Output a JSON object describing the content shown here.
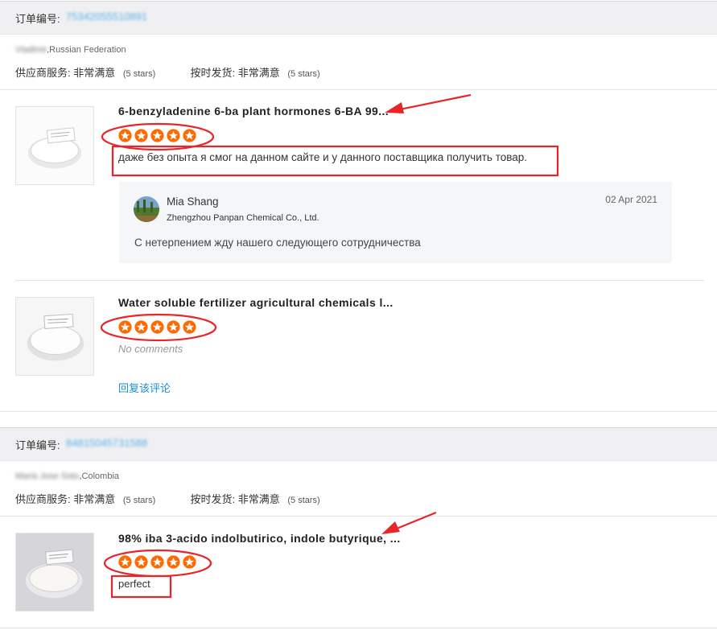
{
  "orders": [
    {
      "order_label": "订单编号:",
      "order_number": "75342055510891",
      "buyer_name": "Vladimir",
      "country": ",Russian Federation",
      "supplier_service_label": "供应商服务:",
      "supplier_service_value": "非常满意",
      "supplier_service_stars": "(5 stars)",
      "shipping_label": "按时发货:",
      "shipping_value": "非常满意",
      "shipping_stars": "(5 stars)",
      "products": [
        {
          "title": "6-benzyladenine 6-ba plant hormones 6-BA 99...",
          "rating": 5,
          "review": "даже без опыта я смог на данном сайте и у данного поставщика получить товар.",
          "reply": {
            "name": "Mia Shang",
            "company": "Zhengzhou Panpan Chemical Co., Ltd.",
            "date": "02 Apr 2021",
            "message": "С нетерпением жду нашего следующего сотрудничества"
          }
        },
        {
          "title": "Water soluble fertilizer agricultural chemicals l...",
          "rating": 5,
          "no_comments": "No comments",
          "reply_link": "回复该评论"
        }
      ]
    },
    {
      "order_label": "订单编号:",
      "order_number": "84815045731588",
      "buyer_name": "Maria Jose Soto",
      "country": ",Colombia",
      "supplier_service_label": "供应商服务:",
      "supplier_service_value": "非常满意",
      "supplier_service_stars": "(5 stars)",
      "shipping_label": "按时发货:",
      "shipping_value": "非常满意",
      "shipping_stars": "(5 stars)",
      "products": [
        {
          "title": "98% iba 3-acido indolbutirico, indole butyrique, ...",
          "rating": 5,
          "review": "perfect"
        }
      ]
    }
  ],
  "colors": {
    "star": "#ff6a00",
    "annotation": "#e8262a",
    "link": "#1a8fd1",
    "header_bg": "#f0f0f2"
  }
}
